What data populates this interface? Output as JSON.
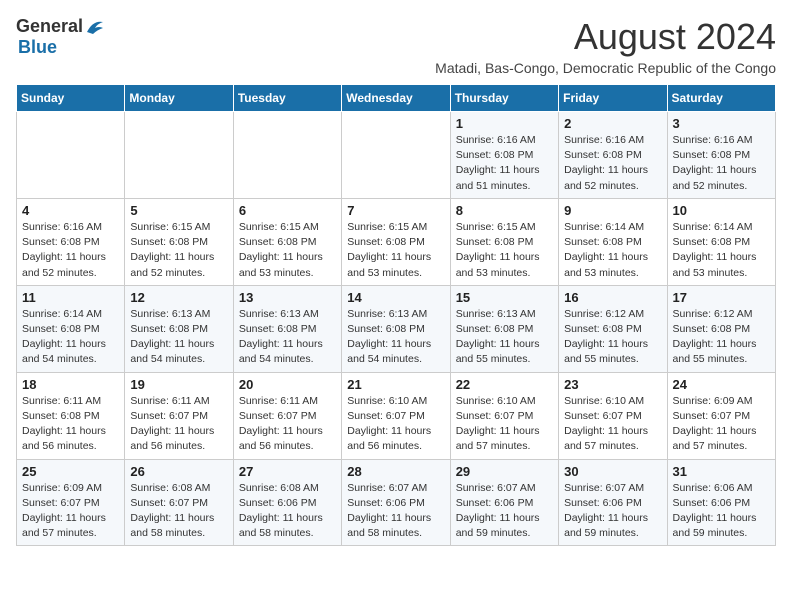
{
  "header": {
    "logo_general": "General",
    "logo_blue": "Blue",
    "month_title": "August 2024",
    "subtitle": "Matadi, Bas-Congo, Democratic Republic of the Congo"
  },
  "days_of_week": [
    "Sunday",
    "Monday",
    "Tuesday",
    "Wednesday",
    "Thursday",
    "Friday",
    "Saturday"
  ],
  "weeks": [
    [
      {
        "day": "",
        "info": ""
      },
      {
        "day": "",
        "info": ""
      },
      {
        "day": "",
        "info": ""
      },
      {
        "day": "",
        "info": ""
      },
      {
        "day": "1",
        "info": "Sunrise: 6:16 AM\nSunset: 6:08 PM\nDaylight: 11 hours and 51 minutes."
      },
      {
        "day": "2",
        "info": "Sunrise: 6:16 AM\nSunset: 6:08 PM\nDaylight: 11 hours and 52 minutes."
      },
      {
        "day": "3",
        "info": "Sunrise: 6:16 AM\nSunset: 6:08 PM\nDaylight: 11 hours and 52 minutes."
      }
    ],
    [
      {
        "day": "4",
        "info": "Sunrise: 6:16 AM\nSunset: 6:08 PM\nDaylight: 11 hours and 52 minutes."
      },
      {
        "day": "5",
        "info": "Sunrise: 6:15 AM\nSunset: 6:08 PM\nDaylight: 11 hours and 52 minutes."
      },
      {
        "day": "6",
        "info": "Sunrise: 6:15 AM\nSunset: 6:08 PM\nDaylight: 11 hours and 53 minutes."
      },
      {
        "day": "7",
        "info": "Sunrise: 6:15 AM\nSunset: 6:08 PM\nDaylight: 11 hours and 53 minutes."
      },
      {
        "day": "8",
        "info": "Sunrise: 6:15 AM\nSunset: 6:08 PM\nDaylight: 11 hours and 53 minutes."
      },
      {
        "day": "9",
        "info": "Sunrise: 6:14 AM\nSunset: 6:08 PM\nDaylight: 11 hours and 53 minutes."
      },
      {
        "day": "10",
        "info": "Sunrise: 6:14 AM\nSunset: 6:08 PM\nDaylight: 11 hours and 53 minutes."
      }
    ],
    [
      {
        "day": "11",
        "info": "Sunrise: 6:14 AM\nSunset: 6:08 PM\nDaylight: 11 hours and 54 minutes."
      },
      {
        "day": "12",
        "info": "Sunrise: 6:13 AM\nSunset: 6:08 PM\nDaylight: 11 hours and 54 minutes."
      },
      {
        "day": "13",
        "info": "Sunrise: 6:13 AM\nSunset: 6:08 PM\nDaylight: 11 hours and 54 minutes."
      },
      {
        "day": "14",
        "info": "Sunrise: 6:13 AM\nSunset: 6:08 PM\nDaylight: 11 hours and 54 minutes."
      },
      {
        "day": "15",
        "info": "Sunrise: 6:13 AM\nSunset: 6:08 PM\nDaylight: 11 hours and 55 minutes."
      },
      {
        "day": "16",
        "info": "Sunrise: 6:12 AM\nSunset: 6:08 PM\nDaylight: 11 hours and 55 minutes."
      },
      {
        "day": "17",
        "info": "Sunrise: 6:12 AM\nSunset: 6:08 PM\nDaylight: 11 hours and 55 minutes."
      }
    ],
    [
      {
        "day": "18",
        "info": "Sunrise: 6:11 AM\nSunset: 6:08 PM\nDaylight: 11 hours and 56 minutes."
      },
      {
        "day": "19",
        "info": "Sunrise: 6:11 AM\nSunset: 6:07 PM\nDaylight: 11 hours and 56 minutes."
      },
      {
        "day": "20",
        "info": "Sunrise: 6:11 AM\nSunset: 6:07 PM\nDaylight: 11 hours and 56 minutes."
      },
      {
        "day": "21",
        "info": "Sunrise: 6:10 AM\nSunset: 6:07 PM\nDaylight: 11 hours and 56 minutes."
      },
      {
        "day": "22",
        "info": "Sunrise: 6:10 AM\nSunset: 6:07 PM\nDaylight: 11 hours and 57 minutes."
      },
      {
        "day": "23",
        "info": "Sunrise: 6:10 AM\nSunset: 6:07 PM\nDaylight: 11 hours and 57 minutes."
      },
      {
        "day": "24",
        "info": "Sunrise: 6:09 AM\nSunset: 6:07 PM\nDaylight: 11 hours and 57 minutes."
      }
    ],
    [
      {
        "day": "25",
        "info": "Sunrise: 6:09 AM\nSunset: 6:07 PM\nDaylight: 11 hours and 57 minutes."
      },
      {
        "day": "26",
        "info": "Sunrise: 6:08 AM\nSunset: 6:07 PM\nDaylight: 11 hours and 58 minutes."
      },
      {
        "day": "27",
        "info": "Sunrise: 6:08 AM\nSunset: 6:06 PM\nDaylight: 11 hours and 58 minutes."
      },
      {
        "day": "28",
        "info": "Sunrise: 6:07 AM\nSunset: 6:06 PM\nDaylight: 11 hours and 58 minutes."
      },
      {
        "day": "29",
        "info": "Sunrise: 6:07 AM\nSunset: 6:06 PM\nDaylight: 11 hours and 59 minutes."
      },
      {
        "day": "30",
        "info": "Sunrise: 6:07 AM\nSunset: 6:06 PM\nDaylight: 11 hours and 59 minutes."
      },
      {
        "day": "31",
        "info": "Sunrise: 6:06 AM\nSunset: 6:06 PM\nDaylight: 11 hours and 59 minutes."
      }
    ]
  ]
}
